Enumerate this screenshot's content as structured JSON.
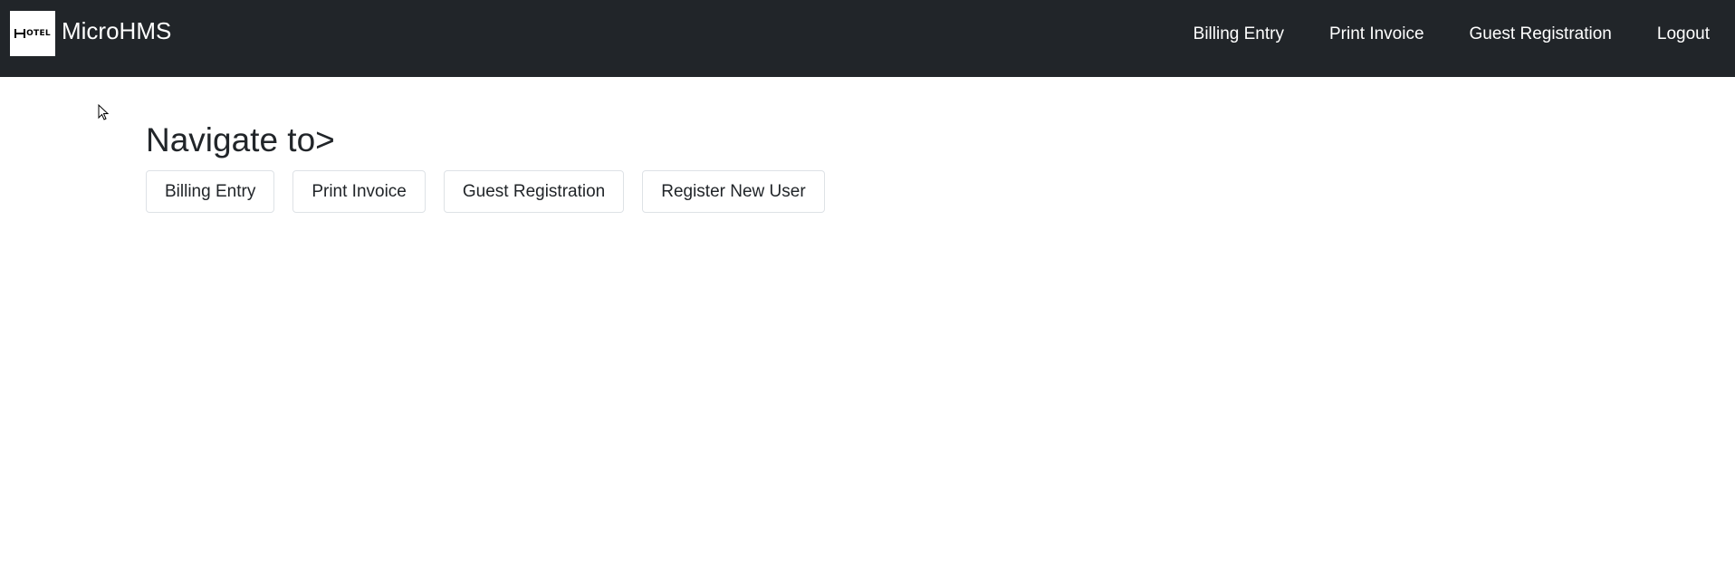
{
  "app": {
    "brand_name": "MicroHMS",
    "logo_text": "OTEL",
    "logo_icon": "hotel-logo-icon"
  },
  "navbar": {
    "links": [
      {
        "label": "Billing Entry"
      },
      {
        "label": "Print Invoice"
      },
      {
        "label": "Guest Registration"
      },
      {
        "label": "Logout"
      }
    ]
  },
  "main": {
    "heading": "Navigate to>",
    "buttons": [
      {
        "label": "Billing Entry"
      },
      {
        "label": "Print Invoice"
      },
      {
        "label": "Guest Registration"
      },
      {
        "label": "Register New User"
      }
    ]
  },
  "colors": {
    "navbar_bg": "#212529",
    "text": "#212529",
    "button_border": "#dee2e6"
  }
}
